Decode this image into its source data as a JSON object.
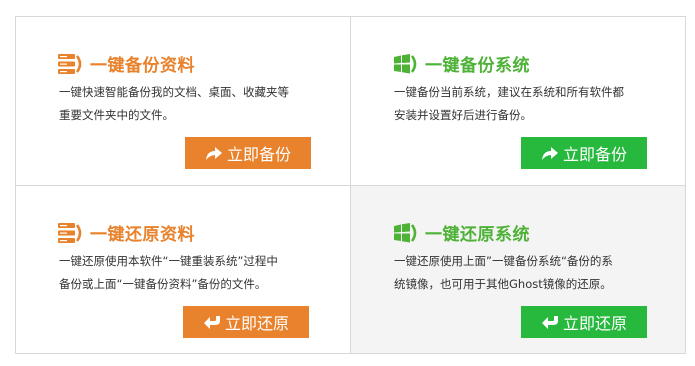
{
  "colors": {
    "orange": "#e8822c",
    "green": "#27b83e",
    "title_green": "#4db236"
  },
  "cards": [
    {
      "title": "一键备份资料",
      "icon": "server-icon",
      "desc_line1": "一键快速智能备份我的文档、桌面、收藏夹等",
      "desc_line2": "重要文件夹中的文件。",
      "button_label": "立即备份",
      "button_icon": "forward-arrow-icon"
    },
    {
      "title": "一键备份系统",
      "icon": "windows-icon",
      "desc_line1": "一键备份当前系统，建议在系统和所有软件都",
      "desc_line2": "安装并设置好后进行备份。",
      "button_label": "立即备份",
      "button_icon": "forward-arrow-icon"
    },
    {
      "title": "一键还原资料",
      "icon": "server-icon",
      "desc_line1": "一键还原使用本软件“一键重装系统”过程中",
      "desc_line2": "备份或上面“一键备份资料”备份的文件。",
      "button_label": "立即还原",
      "button_icon": "return-arrow-icon"
    },
    {
      "title": "一键还原系统",
      "icon": "windows-icon",
      "desc_line1": "一键还原使用上面”一键备份系统“备份的系",
      "desc_line2": "统镜像，也可用于其他Ghost镜像的还原。",
      "button_label": "立即还原",
      "button_icon": "return-arrow-icon"
    }
  ]
}
